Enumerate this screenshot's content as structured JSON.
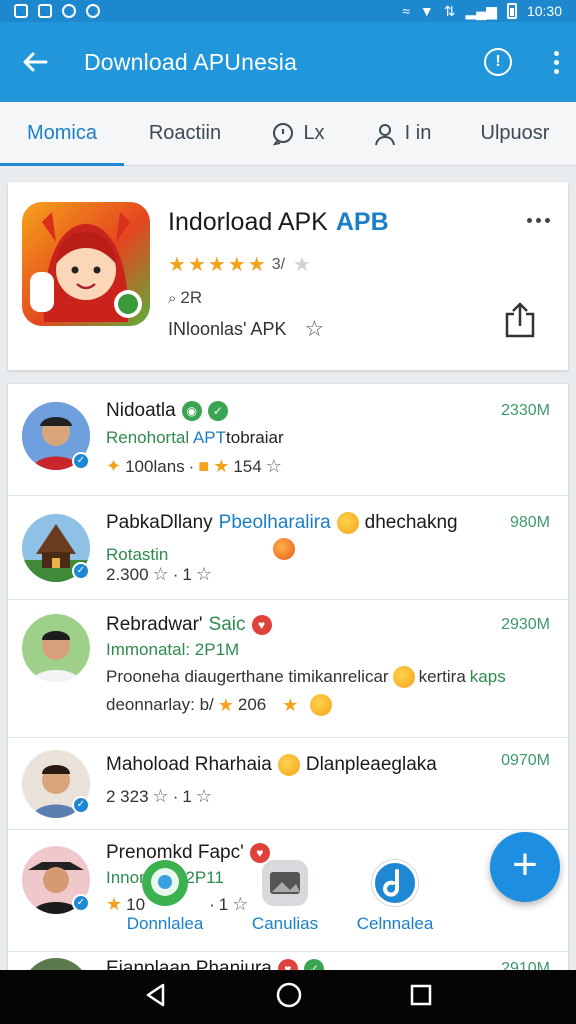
{
  "status": {
    "time": "10:30"
  },
  "appbar": {
    "title": "Download APUnesia",
    "info_glyph": "!"
  },
  "tabs": [
    {
      "label": "Momica"
    },
    {
      "label": "Roactiin"
    },
    {
      "label": "Lx"
    },
    {
      "label": "I in"
    },
    {
      "label": "Ulpuosr"
    }
  ],
  "hero": {
    "title": "Indorload APK",
    "title_badge": "APB",
    "score": "3/",
    "count": "2R",
    "subtitle": "INloonlas' APK"
  },
  "rows": [
    {
      "title": "Nidoatla",
      "size": "2330M",
      "sub_a": "Renohortal ",
      "sub_b": "APT",
      "sub_c": "tobraiar",
      "meta_a": "100lans",
      "meta_b": "154"
    },
    {
      "title": "PabkaDllany",
      "title_b": "Pbeolharalira",
      "title_c": "dhechakng",
      "size": "980M",
      "sub_a": "Rotastin",
      "meta_a": "2.300",
      "meta_b": "1"
    },
    {
      "title": "Rebradwar'",
      "title_b": "Saic",
      "size": "2930M",
      "sub_a": "Immonatal: 2P1M",
      "meta_a": "Prooneha diaugerthane timikanrelicar",
      "meta_b": "kertira",
      "meta_c": "kaps",
      "meta_d": "deonnarlay: b/",
      "meta_e": "206"
    },
    {
      "title": "Mahoload Rharhaia",
      "title_b": "Dlanpleaeglaka",
      "size": "0970M",
      "meta_a": "2 323",
      "meta_b": "1"
    },
    {
      "title": "Prenomkd Fapc'",
      "sub_a": "Innomaal: 2P11",
      "meta_a": "10",
      "meta_b": "1"
    },
    {
      "title": "Eianplaan Phaniura",
      "size": "2910M"
    }
  ],
  "bottom_tabs": [
    {
      "label": "Donnlalea"
    },
    {
      "label": "Canulias"
    },
    {
      "label": "Celnnalea"
    }
  ],
  "fab": {
    "label": "+"
  },
  "colors": {
    "primary": "#2196db",
    "accent": "#1e88d4",
    "green_text": "#2e8a4f",
    "star": "#f3a21b"
  }
}
